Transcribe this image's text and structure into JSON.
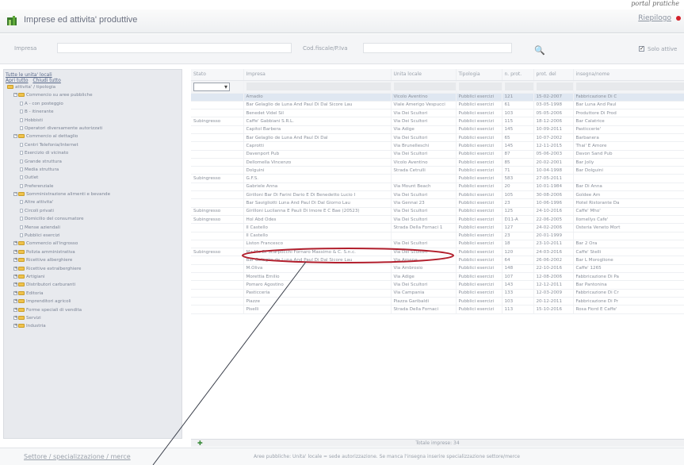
{
  "caption_fragment": "portal pratiche",
  "app": {
    "title": "Imprese ed attivita' produttive",
    "riepilogo": "Riepilogo"
  },
  "filters": {
    "impresa_label": "Impresa",
    "cf_label": "Cod.fiscale/P.Iva",
    "solo_attive_label": "Solo attive",
    "solo_attive_checked": true
  },
  "sidebar": {
    "title": "Tutte le unita' locali",
    "expand_all": "Apri tutto",
    "collapse_all": "Chiudi tutto",
    "root": "attivita' / tipologia",
    "items": [
      {
        "label": "Commercio su aree pubbliche",
        "level": 1,
        "type": "folder",
        "pm": "−"
      },
      {
        "label": "A - con posteggio",
        "level": 2,
        "type": "leaf"
      },
      {
        "label": "B - itinerante",
        "level": 2,
        "type": "leaf"
      },
      {
        "label": "Hobbisti",
        "level": 2,
        "type": "leaf"
      },
      {
        "label": "Operatori diversamente autorizzati",
        "level": 2,
        "type": "leaf"
      },
      {
        "label": "Commercio al dettaglio",
        "level": 1,
        "type": "folder",
        "pm": "−"
      },
      {
        "label": "Centri Telefonia/Internet",
        "level": 2,
        "type": "leaf"
      },
      {
        "label": "Esercizio di vicinato",
        "level": 2,
        "type": "leaf"
      },
      {
        "label": "Grande struttura",
        "level": 2,
        "type": "leaf"
      },
      {
        "label": "Media struttura",
        "level": 2,
        "type": "leaf"
      },
      {
        "label": "Outlet",
        "level": 2,
        "type": "leaf"
      },
      {
        "label": "Preferenziale",
        "level": 2,
        "type": "leaf"
      },
      {
        "label": "Somministrazione alimenti e bevande",
        "level": 1,
        "type": "folder",
        "pm": "−"
      },
      {
        "label": "Altre attivita'",
        "level": 2,
        "type": "leaf"
      },
      {
        "label": "Circoli privati",
        "level": 2,
        "type": "leaf"
      },
      {
        "label": "Domicilio del consumatore",
        "level": 2,
        "type": "leaf"
      },
      {
        "label": "Mense aziendali",
        "level": 2,
        "type": "leaf"
      },
      {
        "label": "Pubblici esercizi",
        "level": 2,
        "type": "leaf"
      },
      {
        "label": "Commercio all'ingrosso",
        "level": 1,
        "type": "folder",
        "pm": "+"
      },
      {
        "label": "Polizia amministrativa",
        "level": 1,
        "type": "folder",
        "pm": "+"
      },
      {
        "label": "Ricettive alberghiere",
        "level": 1,
        "type": "folder",
        "pm": "+"
      },
      {
        "label": "Ricettive extralberghiere",
        "level": 1,
        "type": "folder",
        "pm": "+"
      },
      {
        "label": "Artigiani",
        "level": 1,
        "type": "folder",
        "pm": "+"
      },
      {
        "label": "Distributori carburanti",
        "level": 1,
        "type": "folder",
        "pm": "+"
      },
      {
        "label": "Editoria",
        "level": 1,
        "type": "folder",
        "pm": "+"
      },
      {
        "label": "Imprenditori agricoli",
        "level": 1,
        "type": "folder",
        "pm": "+"
      },
      {
        "label": "Forme speciali di vendita",
        "level": 1,
        "type": "folder",
        "pm": "+"
      },
      {
        "label": "Servizi",
        "level": 1,
        "type": "folder",
        "pm": "+"
      },
      {
        "label": "Industria",
        "level": 1,
        "type": "folder",
        "pm": "+"
      }
    ]
  },
  "table": {
    "columns": [
      "Stato",
      "Impresa",
      "Unita locale",
      "Tipologia",
      "n. prot.",
      "prot. del",
      "insegna/nome"
    ],
    "rows": [
      [
        "",
        "Amadio",
        "Vicolo Aventino",
        "Pubblici esercizi",
        "121",
        "15-02-2007",
        "Fabbricazione Di C"
      ],
      [
        "",
        "Bar Gelaglio de Luna And Paul Di Dal Sicore Lau",
        "Viale Amerigo Vespucci",
        "Pubblici esercizi",
        "61",
        "03-05-1998",
        "Bar Luna And Paul"
      ],
      [
        "",
        "Benedet Videl Sil",
        "Via Dei Scultori",
        "Pubblici esercizi",
        "103",
        "05-05-2006",
        "Produttore Di Prod"
      ],
      [
        "Subingresso",
        "Caffe' Gabbiani S.R.L.",
        "Via Dei Scultori",
        "Pubblici esercizi",
        "115",
        "18-12-2006",
        "Bar Calatrice"
      ],
      [
        "",
        "Capitol Barbera",
        "Via Adige",
        "Pubblici esercizi",
        "145",
        "10-09-2011",
        "Pasticcerie'"
      ],
      [
        "",
        "Bar Gelaglio de Luna And Paul Di Dal",
        "Via Dei Scultori",
        "Pubblici esercizi",
        "65",
        "10-07-2002",
        "Barbanera"
      ],
      [
        "",
        "Caprotti",
        "Via Brunelleschi",
        "Pubblici esercizi",
        "145",
        "12-11-2015",
        "Thai' E Amore"
      ],
      [
        "",
        "Davenport Pub",
        "Via Dei Scultori",
        "Pubblici esercizi",
        "87",
        "05-06-2003",
        "Davon Sand Pub"
      ],
      [
        "",
        "Dellomella Vincenzo",
        "Vicolo Aventino",
        "Pubblici esercizi",
        "85",
        "20-02-2001",
        "Bar Jolly"
      ],
      [
        "",
        "Dolguini",
        "Strada Cetrulli",
        "Pubblici esercizi",
        "71",
        "10-04-1998",
        "Bar Dolguini"
      ],
      [
        "Subingresso",
        "G.F.S.",
        "",
        "Pubblici esercizi",
        "583",
        "27-05-2011",
        ""
      ],
      [
        "",
        "Gabriele Anna",
        "Via Mount Beach",
        "Pubblici esercizi",
        "20",
        "10-01-1984",
        "Bar Di Anna"
      ],
      [
        "",
        "Girilloni Bar Di Farini Dario E Di Benedetto Lucio I",
        "Via Dei Scultori",
        "Pubblici esercizi",
        "105",
        "30-08-2006",
        "Goldee Am"
      ],
      [
        "",
        "Bar Savigliotti Luna And Paul Di Dal Giorno Lau",
        "Via Gennai 23",
        "Pubblici esercizi",
        "23",
        "10-06-1996",
        "Hotel Ristorante Da"
      ],
      [
        "Subingresso",
        "Girilloni Lucilanna E Pauli Di Imore E C Bae (20523)",
        "Via Dei Scultori",
        "Pubblici esercizi",
        "125",
        "24-10-2016",
        "Caffe' Mho'"
      ],
      [
        "Subingresso",
        "Hol Abd Odes",
        "Via Dei Scultori",
        "Pubblici esercizi",
        "D11-A",
        "22-06-2005",
        "Ilomellys Cafe'"
      ],
      [
        "",
        "Il Castello",
        "Strada Della Fornaci 1",
        "Pubblici esercizi",
        "127",
        "24-02-2006",
        "Osteria Veneto Mort"
      ],
      [
        "",
        "Il Castello",
        "",
        "Pubblici esercizi",
        "23",
        "20-01-1999",
        ""
      ],
      [
        "",
        "Liston Francesco",
        "Via Dei Scultori",
        "Pubblici esercizi",
        "18",
        "23-10-2011",
        "Bar 2 Ora"
      ],
      [
        "Subingresso",
        "Ma Ma Di Scarpocchi Fornaro Massimo & C. S.n.c.",
        "Via Dei Scultori",
        "Pubblici esercizi",
        "120",
        "24-03-2016",
        "Caffe' Stelli"
      ],
      [
        "",
        "Bar Gelaglio de Luna And Paul Di Dal Sicore Lau",
        "Via Amene",
        "Pubblici esercizi",
        "64",
        "26-06-2002",
        "Bar L Moroglione"
      ],
      [
        "",
        "M.Oliva",
        "Via Ambrosio",
        "Pubblici esercizi",
        "148",
        "22-10-2016",
        "Caffe' 1265"
      ],
      [
        "",
        "Morettia Emilio",
        "Via Adige",
        "Pubblici esercizi",
        "107",
        "12-08-2006",
        "Fabbricazione Di Pa"
      ],
      [
        "",
        "Pomaro Agostino",
        "Via Dei Scultori",
        "Pubblici esercizi",
        "143",
        "12-12-2011",
        "Bar Pantonina"
      ],
      [
        "",
        "Pasticceria",
        "Via Campania",
        "Pubblici esercizi",
        "133",
        "12-03-2009",
        "Fabbricazione Di Cr"
      ],
      [
        "",
        "Piazze",
        "Piazza Garibaldi",
        "Pubblici esercizi",
        "103",
        "20-12-2011",
        "Fabbricazione Di Pr"
      ],
      [
        "",
        "Piselli",
        "Strada Della Fornaci",
        "Pubblici esercizi",
        "113",
        "15-10-2016",
        "Rosa Fiord E Caffe'"
      ]
    ]
  },
  "footer": {
    "count": "Totale imprese: 34",
    "settori_link": "Settore / specializzazione / merce",
    "note": "Aree pubbliche: Unita' locale = sede autorizzazione. Se manca l'insegna inserire specializzazione settore/merce"
  }
}
